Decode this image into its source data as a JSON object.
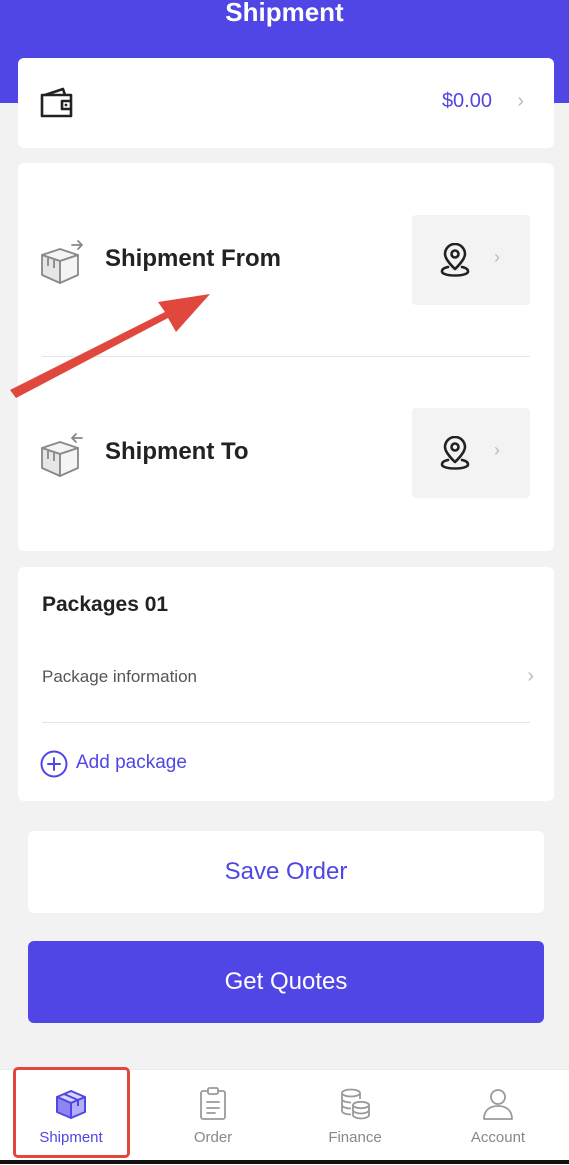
{
  "header": {
    "title": "Shipment"
  },
  "wallet": {
    "amount": "$0.00",
    "icon": "wallet-icon"
  },
  "route": {
    "from_label": "Shipment From",
    "to_label": "Shipment To",
    "location_icon": "location-pin-icon"
  },
  "packages": {
    "title": "Packages 01",
    "info_label": "Package information",
    "add_label": "Add package"
  },
  "actions": {
    "save_label": "Save Order",
    "quotes_label": "Get Quotes"
  },
  "tabbar": {
    "items": [
      {
        "label": "Shipment",
        "icon": "package-icon",
        "active": true
      },
      {
        "label": "Order",
        "icon": "clipboard-icon",
        "active": false
      },
      {
        "label": "Finance",
        "icon": "coins-icon",
        "active": false
      },
      {
        "label": "Account",
        "icon": "user-icon",
        "active": false
      }
    ]
  },
  "colors": {
    "brand": "#5046e5",
    "annotation": "#e0473d",
    "background": "#f2f2f2"
  }
}
